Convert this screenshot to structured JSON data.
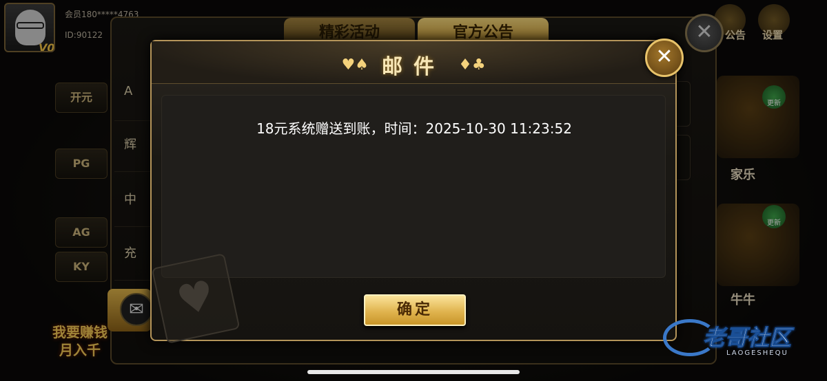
{
  "profile": {
    "member": "会员180*****4763",
    "id": "ID:90122",
    "vip_level": "V0"
  },
  "top_right": {
    "notice_label": "公告",
    "settings_label": "设置"
  },
  "left_rail": {
    "items": [
      "开元",
      "PG",
      "AG",
      "KY"
    ]
  },
  "right_rail": {
    "labels": [
      "家乐",
      "牛牛"
    ],
    "update_label": "更新"
  },
  "promo": {
    "line1": "我要赚钱",
    "line2": "月入千"
  },
  "outer_panel": {
    "tabs": [
      "精彩活动",
      "官方公告"
    ],
    "list_items": [
      "A",
      "辉",
      "中",
      "充"
    ]
  },
  "dialog": {
    "title": "邮件",
    "message": "18元系统赠送到账，时间：2025-10-30 11:23:52",
    "confirm_label": "确定",
    "close_symbol": "✕"
  },
  "watermark": {
    "text": "老哥社区",
    "sub": "LAOGESHEQU"
  },
  "colors": {
    "gold": "#f4d27c",
    "dialog_border": "#b5955a",
    "button_gold": "#e0b44f",
    "background": "#0c0b09"
  }
}
